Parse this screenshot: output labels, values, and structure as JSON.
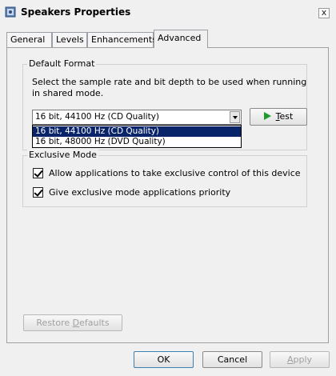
{
  "window": {
    "title": "Speakers Properties",
    "close_glyph": "x"
  },
  "tabs": [
    {
      "label": "General",
      "active": false
    },
    {
      "label": "Levels",
      "active": false
    },
    {
      "label": "Enhancements",
      "active": false
    },
    {
      "label": "Advanced",
      "active": true
    }
  ],
  "default_format": {
    "group_title": "Default Format",
    "description": "Select the sample rate and bit depth to be used when running in shared mode.",
    "selected_value": "16 bit, 44100 Hz (CD Quality)",
    "options": [
      {
        "label": "16 bit, 44100 Hz (CD Quality)",
        "selected": true
      },
      {
        "label": "16 bit, 48000 Hz (DVD Quality)",
        "selected": false
      }
    ],
    "test_button": {
      "label_underlined": "T",
      "label_rest": "est"
    }
  },
  "exclusive_mode": {
    "group_title": "Exclusive Mode",
    "allow_label": "Allow applications to take exclusive control of this device",
    "allow_checked": true,
    "priority_label": "Give exclusive mode applications priority",
    "priority_checked": true
  },
  "restore_defaults": {
    "label_before": "Restore ",
    "label_underlined": "D",
    "label_after": "efaults"
  },
  "footer": {
    "ok_label": "OK",
    "cancel_label": "Cancel",
    "apply_label_underlined": "A",
    "apply_label_rest": "pply"
  },
  "colors": {
    "selection": "#0a246a",
    "play_icon": "#1f9a2e",
    "window_bg": "#f0f0f0"
  }
}
